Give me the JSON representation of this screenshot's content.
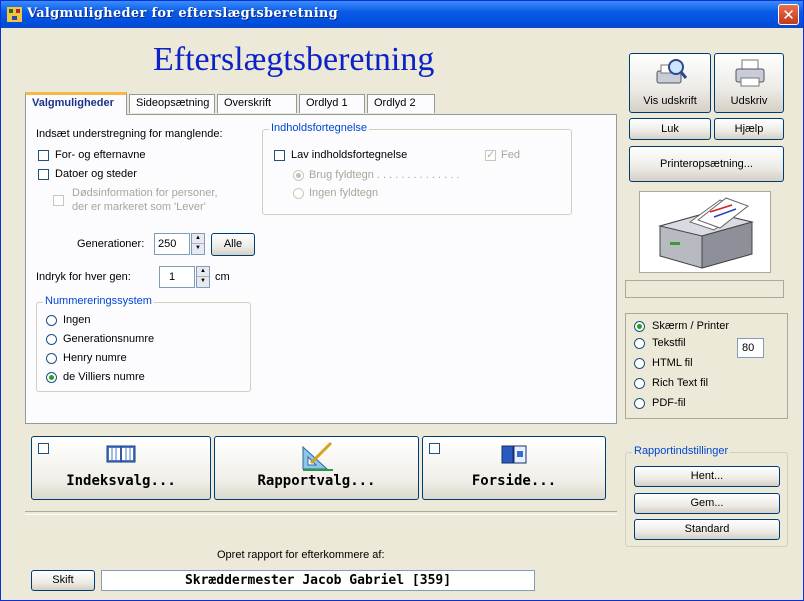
{
  "window": {
    "title": "Valgmuligheder for efterslægtsberetning",
    "close_label": "✕"
  },
  "heading": "Efterslægtsberetning",
  "tabs": [
    {
      "label": "Valgmuligheder",
      "active": true
    },
    {
      "label": "Sideopsætning",
      "active": false
    },
    {
      "label": "Overskrift",
      "active": false
    },
    {
      "label": "Ordlyd 1",
      "active": false
    },
    {
      "label": "Ordlyd 2",
      "active": false
    }
  ],
  "underline": {
    "label": "Indsæt understregning for manglende:",
    "names_label": "For- og efternavne",
    "dates_label": "Datoer og steder",
    "death_info_line1": "Dødsinformation for personer,",
    "death_info_line2": "der er markeret som 'Lever'"
  },
  "toc": {
    "group_title": "Indholdsfortegnelse",
    "create_label": "Lav indholdsfortegnelse",
    "bold_label": "Fed",
    "use_fill_label": "Brug fyldtegn . . . . . . . . . . . . . .",
    "no_fill_label": "Ingen fyldtegn"
  },
  "generations": {
    "label": "Generationer:",
    "value": "250",
    "all_button": "Alle"
  },
  "indent": {
    "label": "Indryk for hver gen:",
    "value": "1",
    "unit": "cm"
  },
  "numbering": {
    "group_title": "Nummereringssystem",
    "options": [
      "Ingen",
      "Generationsnumre",
      "Henry numre",
      "de Villiers numre"
    ],
    "selected": "de Villiers numre"
  },
  "bottom_buttons": {
    "index_label": "Indeksvalg...",
    "report_label": "Rapportvalg...",
    "cover_label": "Forside..."
  },
  "footer": {
    "prompt": "Opret rapport for efterkommere af:",
    "change_button": "Skift",
    "person_name": "Skræddermester Jacob Gabriel [359]"
  },
  "right_panel": {
    "preview_label": "Vis udskrift",
    "print_label": "Udskriv",
    "close_label": "Luk",
    "help_label": "Hjælp",
    "printer_setup_label": "Printeropsætning...",
    "output_options": [
      "Skærm / Printer",
      "Tekstfil",
      "HTML fil",
      "Rich Text fil",
      "PDF-fil"
    ],
    "output_selected": "Skærm / Printer",
    "text_width_value": "80",
    "settings_group_title": "Rapportindstillinger",
    "load_label": "Hent...",
    "save_label": "Gem...",
    "default_label": "Standard"
  },
  "colors": {
    "heading": "#0c22c8",
    "group_title": "#0046d5",
    "titlebar": "#0a5be6"
  }
}
